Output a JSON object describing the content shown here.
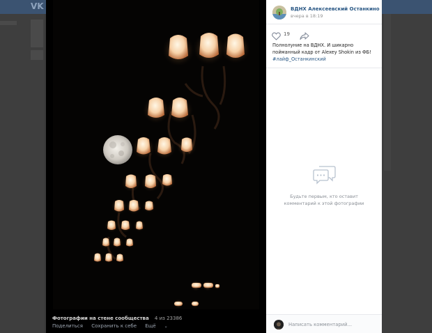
{
  "app": {
    "logo": "VK"
  },
  "post": {
    "community_name": "ВДНХ Алексеевский Останкино",
    "time": "вчера в 18:19",
    "likes": "19",
    "text": "Полнолуние на ВДНХ. И шикарно пойманный кадр от Alexey Shokin из ФБ!",
    "hashtag": "#лайф_Останкинский"
  },
  "comments": {
    "empty_text": "Будьте первым, кто оставит комментарий к этой фотографии",
    "input_placeholder": "Написать комментарий..."
  },
  "photo_footer": {
    "album_title": "Фотографии на стене сообщества",
    "counter": "4 из 23386",
    "share_label": "Поделиться",
    "save_label": "Сохранить к себе",
    "more_label": "Ещё"
  },
  "icons": {
    "like": "heart-icon",
    "share": "share-arrow-icon",
    "empty_comments": "speech-bubbles-icon",
    "more": "chevron-down-icon"
  },
  "colors": {
    "link": "#2a5885",
    "header": "#3b5371",
    "overlay": "#3e3e3e"
  }
}
